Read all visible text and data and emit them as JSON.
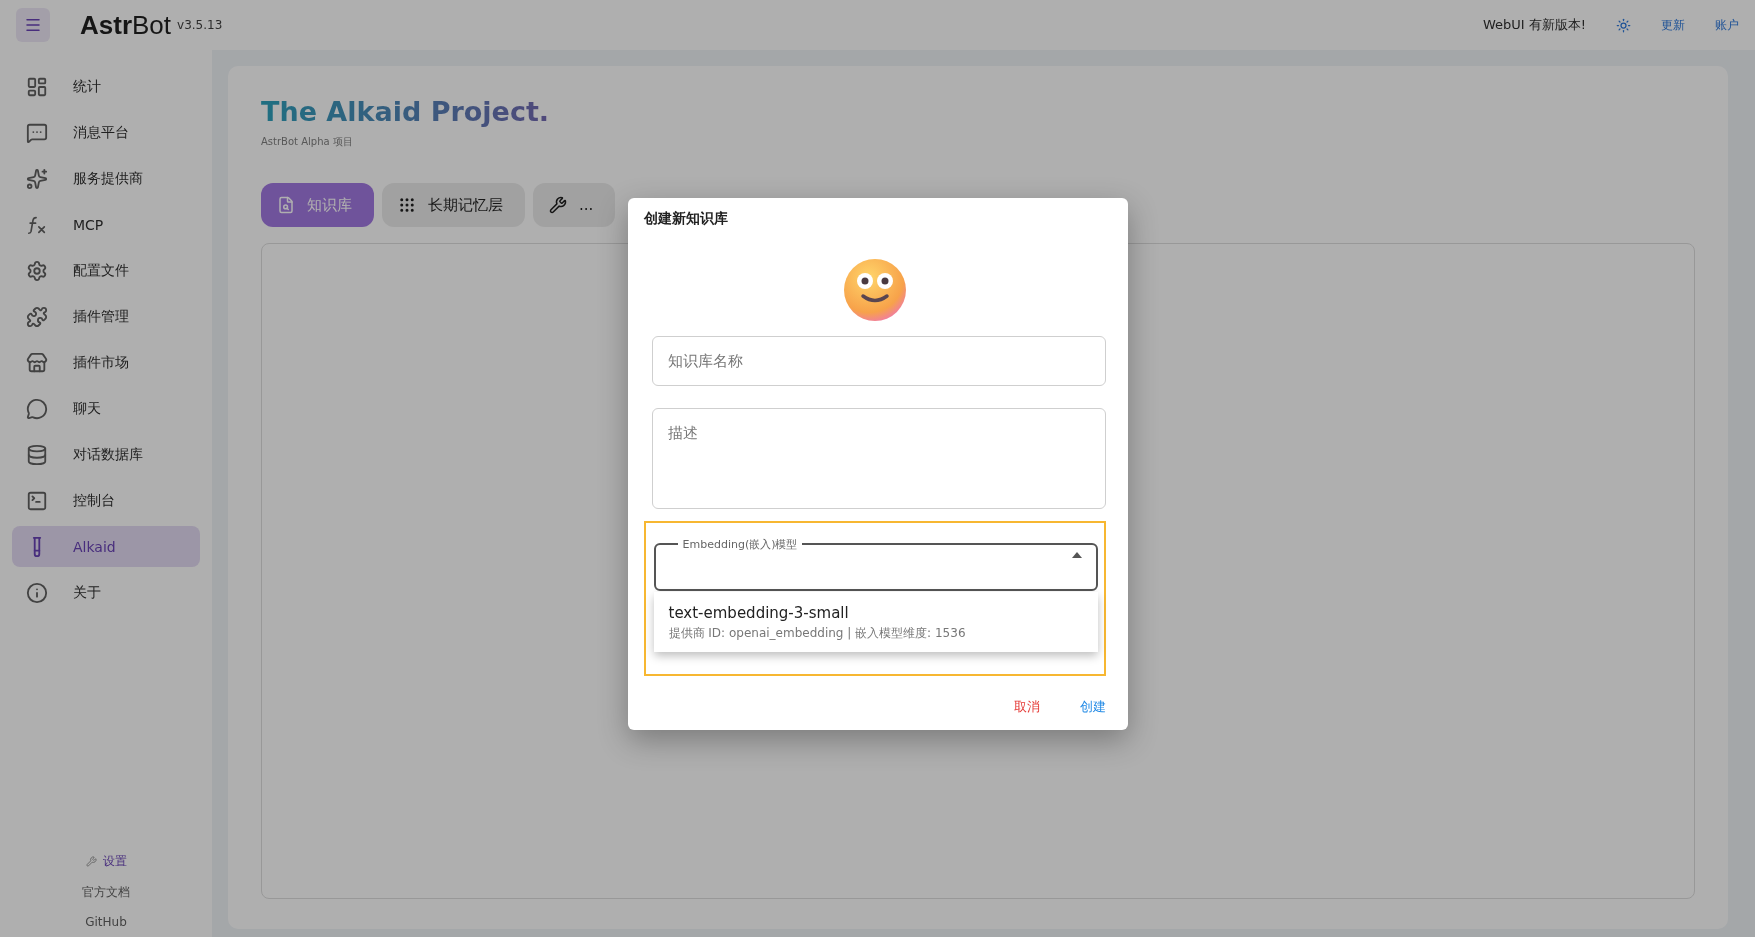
{
  "topbar": {
    "logo_bold": "Astr",
    "logo_light": "Bot",
    "version": "v3.5.13",
    "update_notice": "WebUI 有新版本!",
    "update_link": "更新",
    "account_link": "账户"
  },
  "sidebar": {
    "items": [
      {
        "label": "统计",
        "selected": false
      },
      {
        "label": "消息平台",
        "selected": false
      },
      {
        "label": "服务提供商",
        "selected": false
      },
      {
        "label": "MCP",
        "selected": false
      },
      {
        "label": "配置文件",
        "selected": false
      },
      {
        "label": "插件管理",
        "selected": false
      },
      {
        "label": "插件市场",
        "selected": false
      },
      {
        "label": "聊天",
        "selected": false
      },
      {
        "label": "对话数据库",
        "selected": false
      },
      {
        "label": "控制台",
        "selected": false
      },
      {
        "label": "Alkaid",
        "selected": true
      },
      {
        "label": "关于",
        "selected": false
      }
    ],
    "footer": {
      "settings": "设置",
      "docs": "官方文档",
      "github": "GitHub"
    }
  },
  "page": {
    "title": "The Alkaid Project.",
    "subtitle": "AstrBot Alpha 项目",
    "tabs": [
      {
        "label": "知识库",
        "selected": true
      },
      {
        "label": "长期记忆层",
        "selected": false
      },
      {
        "label": "...",
        "selected": false
      }
    ]
  },
  "dialog": {
    "title": "创建新知识库",
    "name_field": {
      "placeholder": "知识库名称"
    },
    "description_field": {
      "placeholder": "描述"
    },
    "model_select": {
      "label": "Embedding(嵌入)模型",
      "expanded": true,
      "options": [
        {
          "title": "text-embedding-3-small",
          "subtitle": "提供商 ID: openai_embedding | 嵌入模型维度: 1536",
          "selected": false
        }
      ]
    },
    "buttons": {
      "cancel": "取消",
      "create": "创建"
    }
  }
}
